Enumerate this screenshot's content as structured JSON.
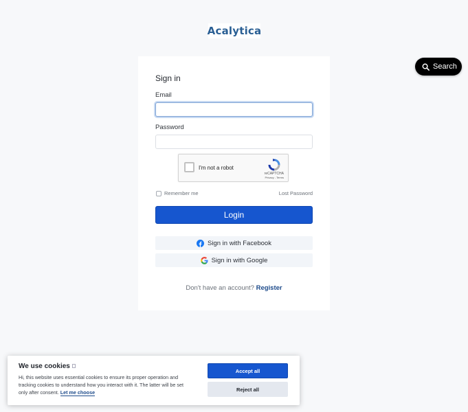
{
  "brand": {
    "name": "Acalytica",
    "color": "#2a5f94"
  },
  "search_widget": {
    "label": "Search",
    "icon": "search-icon"
  },
  "login_card": {
    "title": "Sign in",
    "email_label": "Email",
    "email_value": "",
    "password_label": "Password",
    "password_value": "",
    "captcha": {
      "label": "I'm not a robot",
      "brand": "reCAPTCHA",
      "links": "Privacy - Terms",
      "icon": "recaptcha-icon"
    },
    "remember_label": "Remember me",
    "remember_checked": false,
    "lost_password": "Lost Password",
    "login_button": "Login",
    "facebook_button": "Sign in with Facebook",
    "google_button": "Sign in with Google",
    "register_prompt": "Don't have an account?",
    "register_link": "Register",
    "accent_color": "#1656cf"
  },
  "cookie_banner": {
    "title": "We use cookies",
    "text": "Hi, this website uses essential cookies to ensure its proper operation and tracking cookies to understand how you interact with it. The latter will be set only after consent.",
    "link": "Let me choose",
    "accept": "Accept all",
    "reject": "Reject all"
  }
}
